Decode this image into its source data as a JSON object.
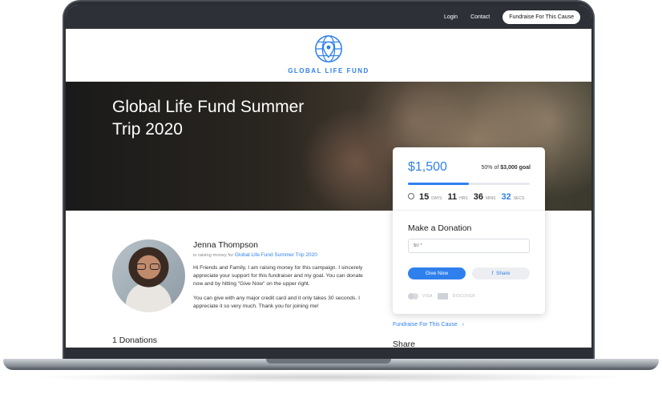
{
  "nav": {
    "login": "Login",
    "contact": "Contact",
    "cta": "Fundraise For This Cause"
  },
  "brand": {
    "name": "GLOBAL LIFE FUND",
    "logo_icon": "globe-pin-icon",
    "accent": "#2f80ed"
  },
  "hero": {
    "title": "Global Life Fund Summer Trip 2020"
  },
  "donation_card": {
    "raised": "$1,500",
    "goal_percent": "50%",
    "goal_of": "of",
    "goal_amount": "$3,000 goal",
    "progress_fraction": 0.5,
    "countdown": {
      "days": "15",
      "days_label": "DAYS",
      "hrs": "11",
      "hrs_label": "HRS",
      "mins": "36",
      "mins_label": "MINS",
      "secs": "32",
      "secs_label": "SECS"
    },
    "make_donation_title": "Make a Donation",
    "amount_placeholder": "$0 *",
    "give_button": "Give Now",
    "share_button": "Share",
    "payment_visa": "VISA",
    "payment_discover": "DISCOVER"
  },
  "fundraiser": {
    "name": "Jenna Thompson",
    "raising_prefix": "is raising money for",
    "campaign_link": "Global Life Fund Summer Trip 2020",
    "story_p1": "Hi Friends and Family, I am raising money for this campaign. I sincerely appreciate your support for this fundraiser and my goal. You can donate now and by hitting \"Give Now\" on the upper right.",
    "story_p2": "You can give with any major credit card and it only takes 30 seconds. I appreciate it so very much. Thank you for joining me!"
  },
  "sections": {
    "donations_title": "1 Donations",
    "fundraise_link": "Fundraise For This Cause",
    "share_title": "Share"
  }
}
